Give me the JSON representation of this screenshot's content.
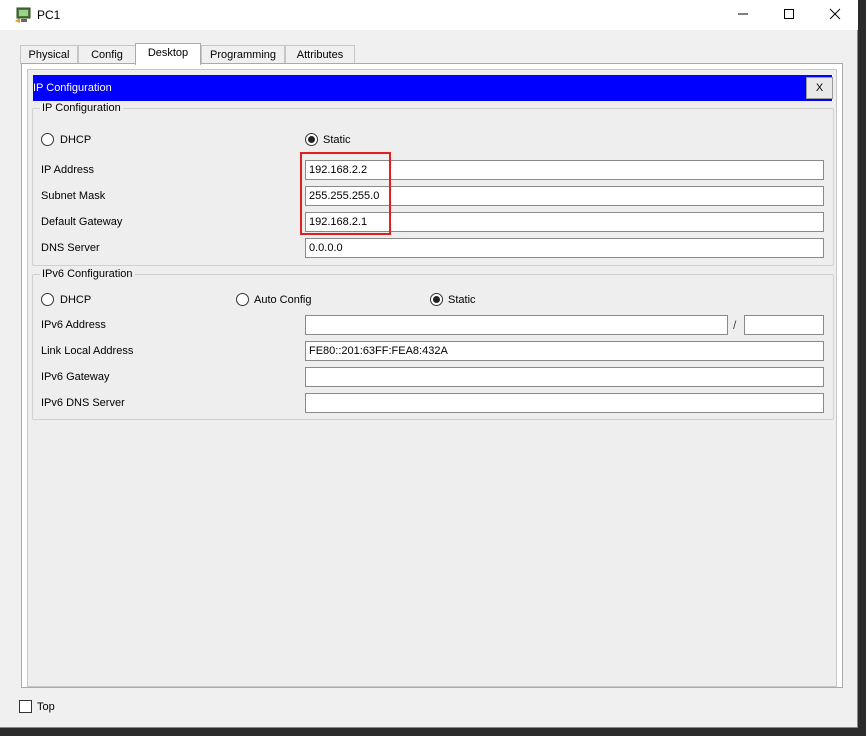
{
  "window": {
    "title": "PC1"
  },
  "tabs": [
    {
      "label": "Physical",
      "active": false
    },
    {
      "label": "Config",
      "active": false
    },
    {
      "label": "Desktop",
      "active": true
    },
    {
      "label": "Programming",
      "active": false
    },
    {
      "label": "Attributes",
      "active": false
    }
  ],
  "panel": {
    "title": "IP Configuration",
    "close_label": "X"
  },
  "ipv4": {
    "group_title": "IP Configuration",
    "dhcp_label": "DHCP",
    "static_label": "Static",
    "selected": "Static",
    "ip_address": {
      "label": "IP Address",
      "value": "192.168.2.2"
    },
    "subnet_mask": {
      "label": "Subnet Mask",
      "value": "255.255.255.0"
    },
    "default_gateway": {
      "label": "Default Gateway",
      "value": "192.168.2.1"
    },
    "dns_server": {
      "label": "DNS Server",
      "value": "0.0.0.0"
    }
  },
  "ipv6": {
    "group_title": "IPv6 Configuration",
    "dhcp_label": "DHCP",
    "auto_label": "Auto Config",
    "static_label": "Static",
    "selected": "Static",
    "address": {
      "label": "IPv6 Address",
      "value": "",
      "separator": "/",
      "prefix": ""
    },
    "link_local": {
      "label": "Link Local Address",
      "value": "FE80::201:63FF:FEA8:432A"
    },
    "gateway": {
      "label": "IPv6 Gateway",
      "value": ""
    },
    "dns_server": {
      "label": "IPv6 DNS Server",
      "value": ""
    }
  },
  "footer": {
    "top_label": "Top",
    "top_checked": false
  },
  "colors": {
    "header_bar": "#0000ff",
    "highlight": "#e02020"
  }
}
